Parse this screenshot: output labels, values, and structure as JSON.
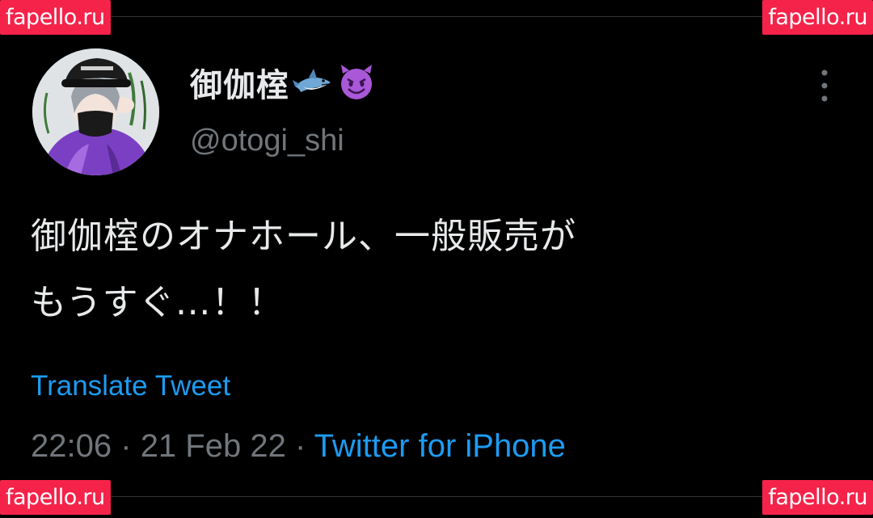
{
  "watermarks": {
    "top_left": "fapello.ru",
    "top_right": "fapello.ru",
    "bottom_left": "fapello.ru",
    "bottom_right": "fapello.ru"
  },
  "tweet": {
    "display_name": "御伽榁",
    "name_emojis": [
      "shark-emoji",
      "smiling-imp-emoji"
    ],
    "handle": "@otogi_shi",
    "text_line1": "御伽榁のオナホール、一般販売が",
    "text_line2": "もうすぐ…！！",
    "translate_label": "Translate Tweet",
    "time": "22:06",
    "separator": "·",
    "date": "21 Feb 22",
    "source": "Twitter for iPhone"
  },
  "icons": {
    "more": "more-vertical-icon"
  },
  "colors": {
    "background": "#000000",
    "text_primary": "#e7e9ea",
    "text_secondary": "#71767b",
    "link": "#1d9bf0",
    "watermark_bg": "#f5234a",
    "avatar_hoodie": "#7b3fc4"
  }
}
